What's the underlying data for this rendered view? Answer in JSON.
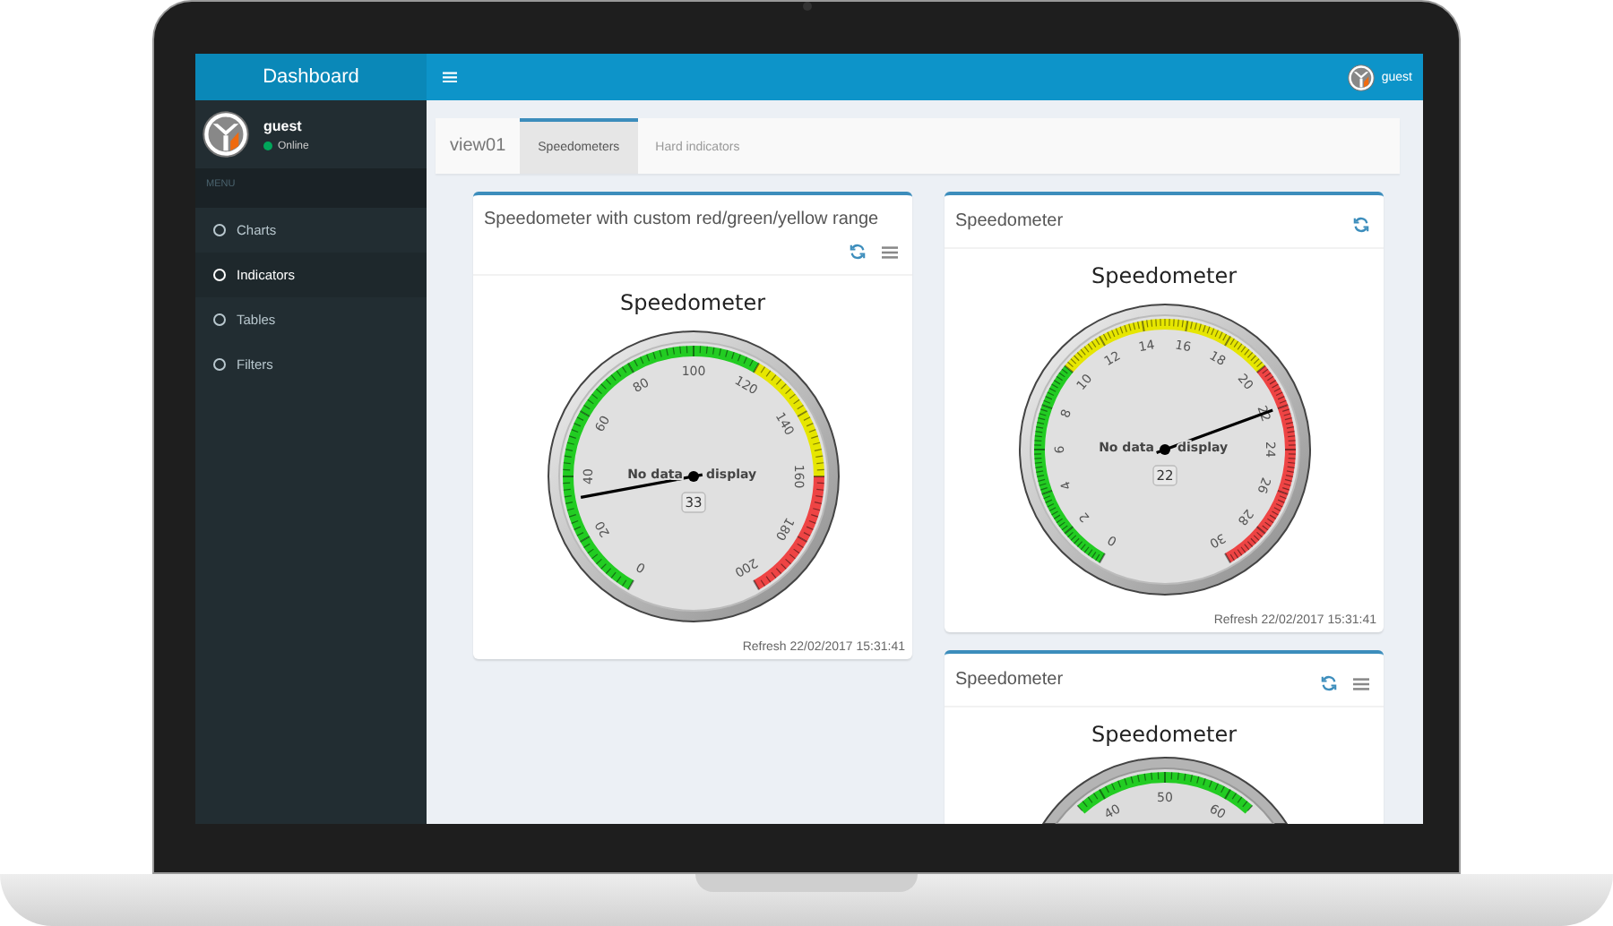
{
  "topbar": {
    "logo": "Dashboard",
    "user": "guest"
  },
  "sidebar": {
    "user": {
      "name": "guest",
      "status": "Online",
      "online": true
    },
    "section": "MENU",
    "items": [
      {
        "label": "Charts",
        "selected": false
      },
      {
        "label": "Indicators",
        "selected": true
      },
      {
        "label": "Tables",
        "selected": false
      },
      {
        "label": "Filters",
        "selected": false
      }
    ]
  },
  "tabs": {
    "title": "view01",
    "items": [
      {
        "label": "Speedometers",
        "selected": true
      },
      {
        "label": "Hard indicators",
        "selected": false
      }
    ]
  },
  "columns": [
    [
      {
        "title": "Speedometer with custom red/green/yellow range",
        "menu": true,
        "chart_title": "Speedometer",
        "gauge": {
          "ticks": [
            {
              "label": "0",
              "color": "#22cc22"
            },
            {
              "label": "20",
              "color": "#22cc22"
            },
            {
              "label": "40",
              "color": "#22cc22"
            },
            {
              "label": "60",
              "color": "#22cc22"
            },
            {
              "label": "80",
              "color": "#22cc22"
            },
            {
              "label": "100",
              "color": "#22cc22"
            },
            {
              "label": "120",
              "color": "#e6e600"
            },
            {
              "label": "140",
              "color": "#e6e600"
            },
            {
              "label": "160",
              "color": "#ee4444"
            },
            {
              "label": "180",
              "color": "#ee4444"
            },
            {
              "label": "200"
            }
          ],
          "level": 0.165,
          "message": [
            "No data",
            "display"
          ],
          "value": "33"
        },
        "footer": "Refresh 22/02/2017 15:31:41"
      }
    ],
    [
      {
        "title": "Speedometer",
        "menu": false,
        "chart_title": "Speedometer",
        "gauge": {
          "ticks": [
            {
              "label": "0",
              "color": "#22cc22"
            },
            {
              "label": "2",
              "color": "#22cc22"
            },
            {
              "label": "4",
              "color": "#22cc22"
            },
            {
              "label": "6",
              "color": "#22cc22"
            },
            {
              "label": "8",
              "color": "#22cc22"
            },
            {
              "label": "10",
              "color": "#e6e600"
            },
            {
              "label": "12",
              "color": "#e6e600"
            },
            {
              "label": "14",
              "color": "#e6e600"
            },
            {
              "label": "16",
              "color": "#e6e600"
            },
            {
              "label": "18",
              "color": "#e6e600"
            },
            {
              "label": "20",
              "color": "#ee4444"
            },
            {
              "label": "22",
              "color": "#ee4444"
            },
            {
              "label": "24",
              "color": "#ee4444"
            },
            {
              "label": "26",
              "color": "#ee4444"
            },
            {
              "label": "28",
              "color": "#ee4444"
            },
            {
              "label": "30"
            }
          ],
          "level": 0.733,
          "message": [
            "No data",
            "display"
          ],
          "value": "22"
        },
        "footer": "Refresh 22/02/2017 15:31:41"
      },
      {
        "title": "Speedometer",
        "menu": true,
        "chart_title": "Speedometer",
        "gauge": {
          "ticks": [
            {
              "label": "40",
              "color": "#22cc22"
            },
            {
              "label": "50",
              "color": "#22cc22"
            },
            {
              "label": "60"
            }
          ]
        }
      }
    ]
  ]
}
